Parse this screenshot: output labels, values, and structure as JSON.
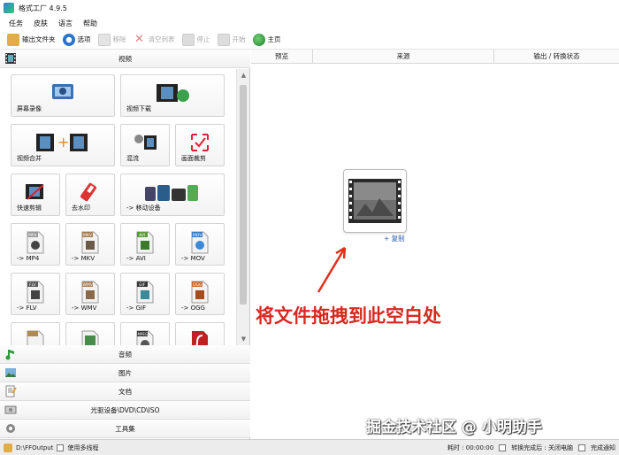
{
  "window": {
    "title": "格式工厂 4.9.5"
  },
  "menu": [
    "任务",
    "皮肤",
    "语言",
    "帮助"
  ],
  "toolbar": [
    {
      "label": "输出文件夹",
      "icon": "folder-icon",
      "enabled": true,
      "color": "#d9a53a"
    },
    {
      "label": "选项",
      "icon": "options-icon",
      "enabled": true,
      "color": "#2a74c9"
    },
    {
      "label": "移除",
      "icon": "remove-icon",
      "enabled": false,
      "color": "#c8c8c8"
    },
    {
      "label": "清空列表",
      "icon": "clear-list-icon",
      "enabled": false,
      "color": "#d97a7a"
    },
    {
      "label": "停止",
      "icon": "stop-icon",
      "enabled": false,
      "color": "#c8c8c8"
    },
    {
      "label": "开始",
      "icon": "start-icon",
      "enabled": false,
      "color": "#c8c8c8"
    },
    {
      "label": "主页",
      "icon": "home-globe-icon",
      "enabled": true,
      "color": "#2e9a3a"
    }
  ],
  "left": {
    "video_header": "视频",
    "tiles": [
      {
        "label": "屏幕录像",
        "icon": "screen-record-icon"
      },
      {
        "label": "视频下载",
        "icon": "video-download-icon"
      },
      {
        "label": "视频合并",
        "icon": "video-merge-icon"
      },
      {
        "label": "混流",
        "icon": "mux-icon"
      },
      {
        "label": "画面裁剪",
        "icon": "crop-icon"
      },
      {
        "label": "快速剪辑",
        "icon": "quick-cut-icon"
      },
      {
        "label": "去水印",
        "icon": "remove-watermark-icon"
      },
      {
        "label": "-> 移动设备",
        "icon": "mobile-device-icon"
      },
      {
        "label": "-> MP4",
        "icon": "mp4-file-icon"
      },
      {
        "label": "-> MKV",
        "icon": "mkv-file-icon"
      },
      {
        "label": "-> AVI",
        "icon": "avi-file-icon"
      },
      {
        "label": "-> MOV",
        "icon": "mov-file-icon"
      },
      {
        "label": "-> FLV",
        "icon": "flv-file-icon"
      },
      {
        "label": "-> WMV",
        "icon": "wmv-file-icon"
      },
      {
        "label": "-> GIF",
        "icon": "gif-file-icon"
      },
      {
        "label": "-> OGG",
        "icon": "ogg-file-icon"
      }
    ],
    "file_badges": {
      "mp4": "MP4",
      "mkv": "MKV",
      "avi": "AVI",
      "mov": "MOV",
      "flv": "FLV",
      "wmv": "WMV",
      "gif": "GIF",
      "ogg": "OGG",
      "mpeg": "MPEG"
    },
    "categories": [
      {
        "label": "音频",
        "icon": "audio-icon"
      },
      {
        "label": "图片",
        "icon": "picture-icon"
      },
      {
        "label": "文档",
        "icon": "document-icon"
      },
      {
        "label": "光驱设备\\DVD\\CD\\ISO",
        "icon": "disc-icon"
      },
      {
        "label": "工具集",
        "icon": "toolbox-icon"
      }
    ]
  },
  "table": {
    "columns": [
      "预览",
      "来源",
      "输出 / 转换状态"
    ]
  },
  "drop": {
    "copy_label": "+ 复制",
    "hint": "将文件拖拽到此空白处"
  },
  "watermark": "掘金技术社区 @ 小明助手",
  "status": {
    "output_path": "D:\\FFOutput",
    "multithread": "使用多线程",
    "elapsed": "耗时 : 00:00:00",
    "after_convert": "转换完成后 : 关闭电脑",
    "notify": "完成通知"
  },
  "colors": {
    "hint_red": "#d9281f",
    "link_blue": "#2a5db0"
  }
}
